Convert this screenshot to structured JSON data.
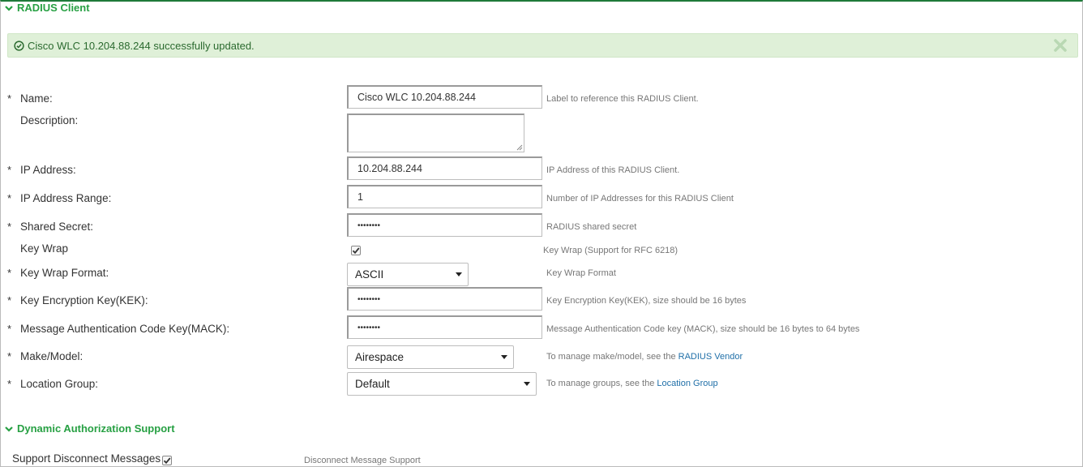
{
  "sections": {
    "radius_client": "RADIUS Client",
    "dynamic_auth": "Dynamic Authorization Support"
  },
  "alert": {
    "message": "Cisco WLC 10.204.88.244 successfully updated."
  },
  "required_mark": "*",
  "fields": {
    "name": {
      "label": "Name:",
      "value": "Cisco WLC 10.204.88.244",
      "help": "Label to reference this RADIUS Client."
    },
    "description": {
      "label": "Description:",
      "value": ""
    },
    "ip_address": {
      "label": "IP Address:",
      "value": "10.204.88.244",
      "help": "IP Address of this RADIUS Client."
    },
    "ip_range": {
      "label": "IP Address Range:",
      "value": "1",
      "help": "Number of IP Addresses for this RADIUS Client"
    },
    "shared_secret": {
      "label": "Shared Secret:",
      "value": "••••••••",
      "help": "RADIUS shared secret"
    },
    "key_wrap": {
      "label": "Key Wrap",
      "checked": true,
      "help": "Key Wrap (Support for RFC 6218)"
    },
    "key_wrap_format": {
      "label": "Key Wrap Format:",
      "value": "ASCII",
      "help": "Key Wrap Format"
    },
    "kek": {
      "label": "Key Encryption Key(KEK):",
      "value": "••••••••",
      "help": "Key Encryption Key(KEK), size should be 16 bytes"
    },
    "mack": {
      "label": "Message Authentication Code Key(MACK):",
      "value": "••••••••",
      "help": "Message Authentication Code key (MACK), size should be 16 bytes to 64 bytes"
    },
    "make_model": {
      "label": "Make/Model:",
      "value": "Airespace",
      "help_prefix": "To manage make/model, see the",
      "help_link": "RADIUS Vendor"
    },
    "location_group": {
      "label": "Location Group:",
      "value": "Default",
      "help_prefix": "To manage groups, see the",
      "help_link": "Location Group"
    },
    "support_disconnect": {
      "label": "Support Disconnect Messages",
      "checked": true,
      "help": "Disconnect Message Support"
    }
  },
  "colors": {
    "accent": "#27a043",
    "alert_bg": "#dff0d8",
    "link": "#1f6fa8"
  }
}
